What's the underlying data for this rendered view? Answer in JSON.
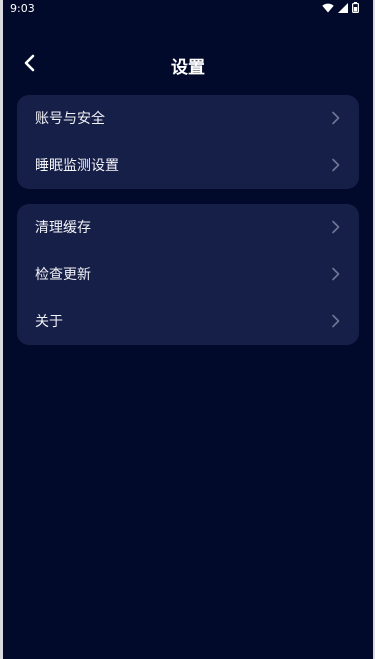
{
  "status_bar": {
    "time": "9:03",
    "icons": [
      "wifi-icon",
      "signal-icon",
      "battery-icon"
    ]
  },
  "header": {
    "title": "设置",
    "back_icon": "back-chevron-icon"
  },
  "groups": [
    {
      "items": [
        {
          "label": "账号与安全"
        },
        {
          "label": "睡眠监测设置"
        }
      ]
    },
    {
      "items": [
        {
          "label": "清理缓存"
        },
        {
          "label": "检查更新"
        },
        {
          "label": "关于"
        }
      ]
    }
  ],
  "colors": {
    "background": "#020a2b",
    "card": "#161f48",
    "chevron": "#6f7694",
    "text": "#f2f3f7"
  }
}
